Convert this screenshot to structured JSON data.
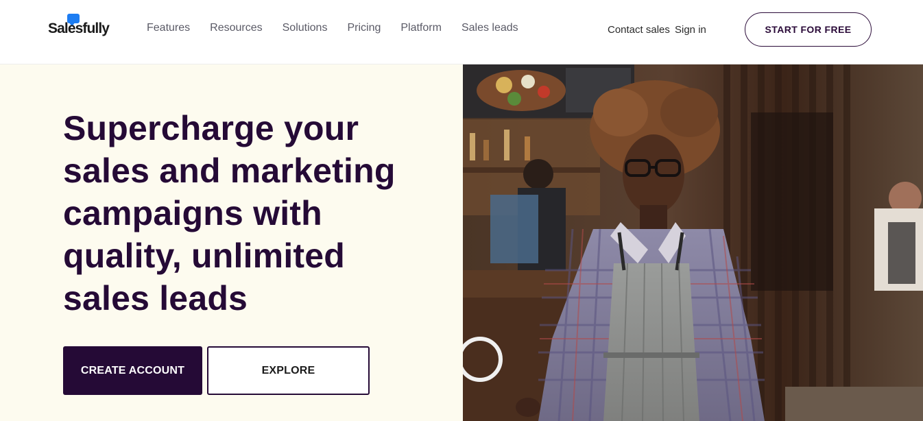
{
  "brand": {
    "name": "Salesfully",
    "accent": "#1d7df2",
    "dark": "#250a36"
  },
  "nav": {
    "items": [
      {
        "label": "Features"
      },
      {
        "label": "Resources"
      },
      {
        "label": "Solutions"
      },
      {
        "label": "Pricing"
      },
      {
        "label": "Platform"
      },
      {
        "label": "Sales leads"
      }
    ]
  },
  "header_actions": {
    "contact_sales": "Contact sales",
    "sign_in": "Sign in",
    "start_for_free": "START FOR FREE"
  },
  "hero": {
    "headline_lines": [
      "Supercharge your",
      "sales and marketing",
      "campaigns with",
      "quality, unlimited",
      "sales leads"
    ],
    "create_account": "CREATE ACCOUNT",
    "explore": "EXPLORE",
    "background": "#fdfbef",
    "image": "photo-cafe-waitress"
  }
}
